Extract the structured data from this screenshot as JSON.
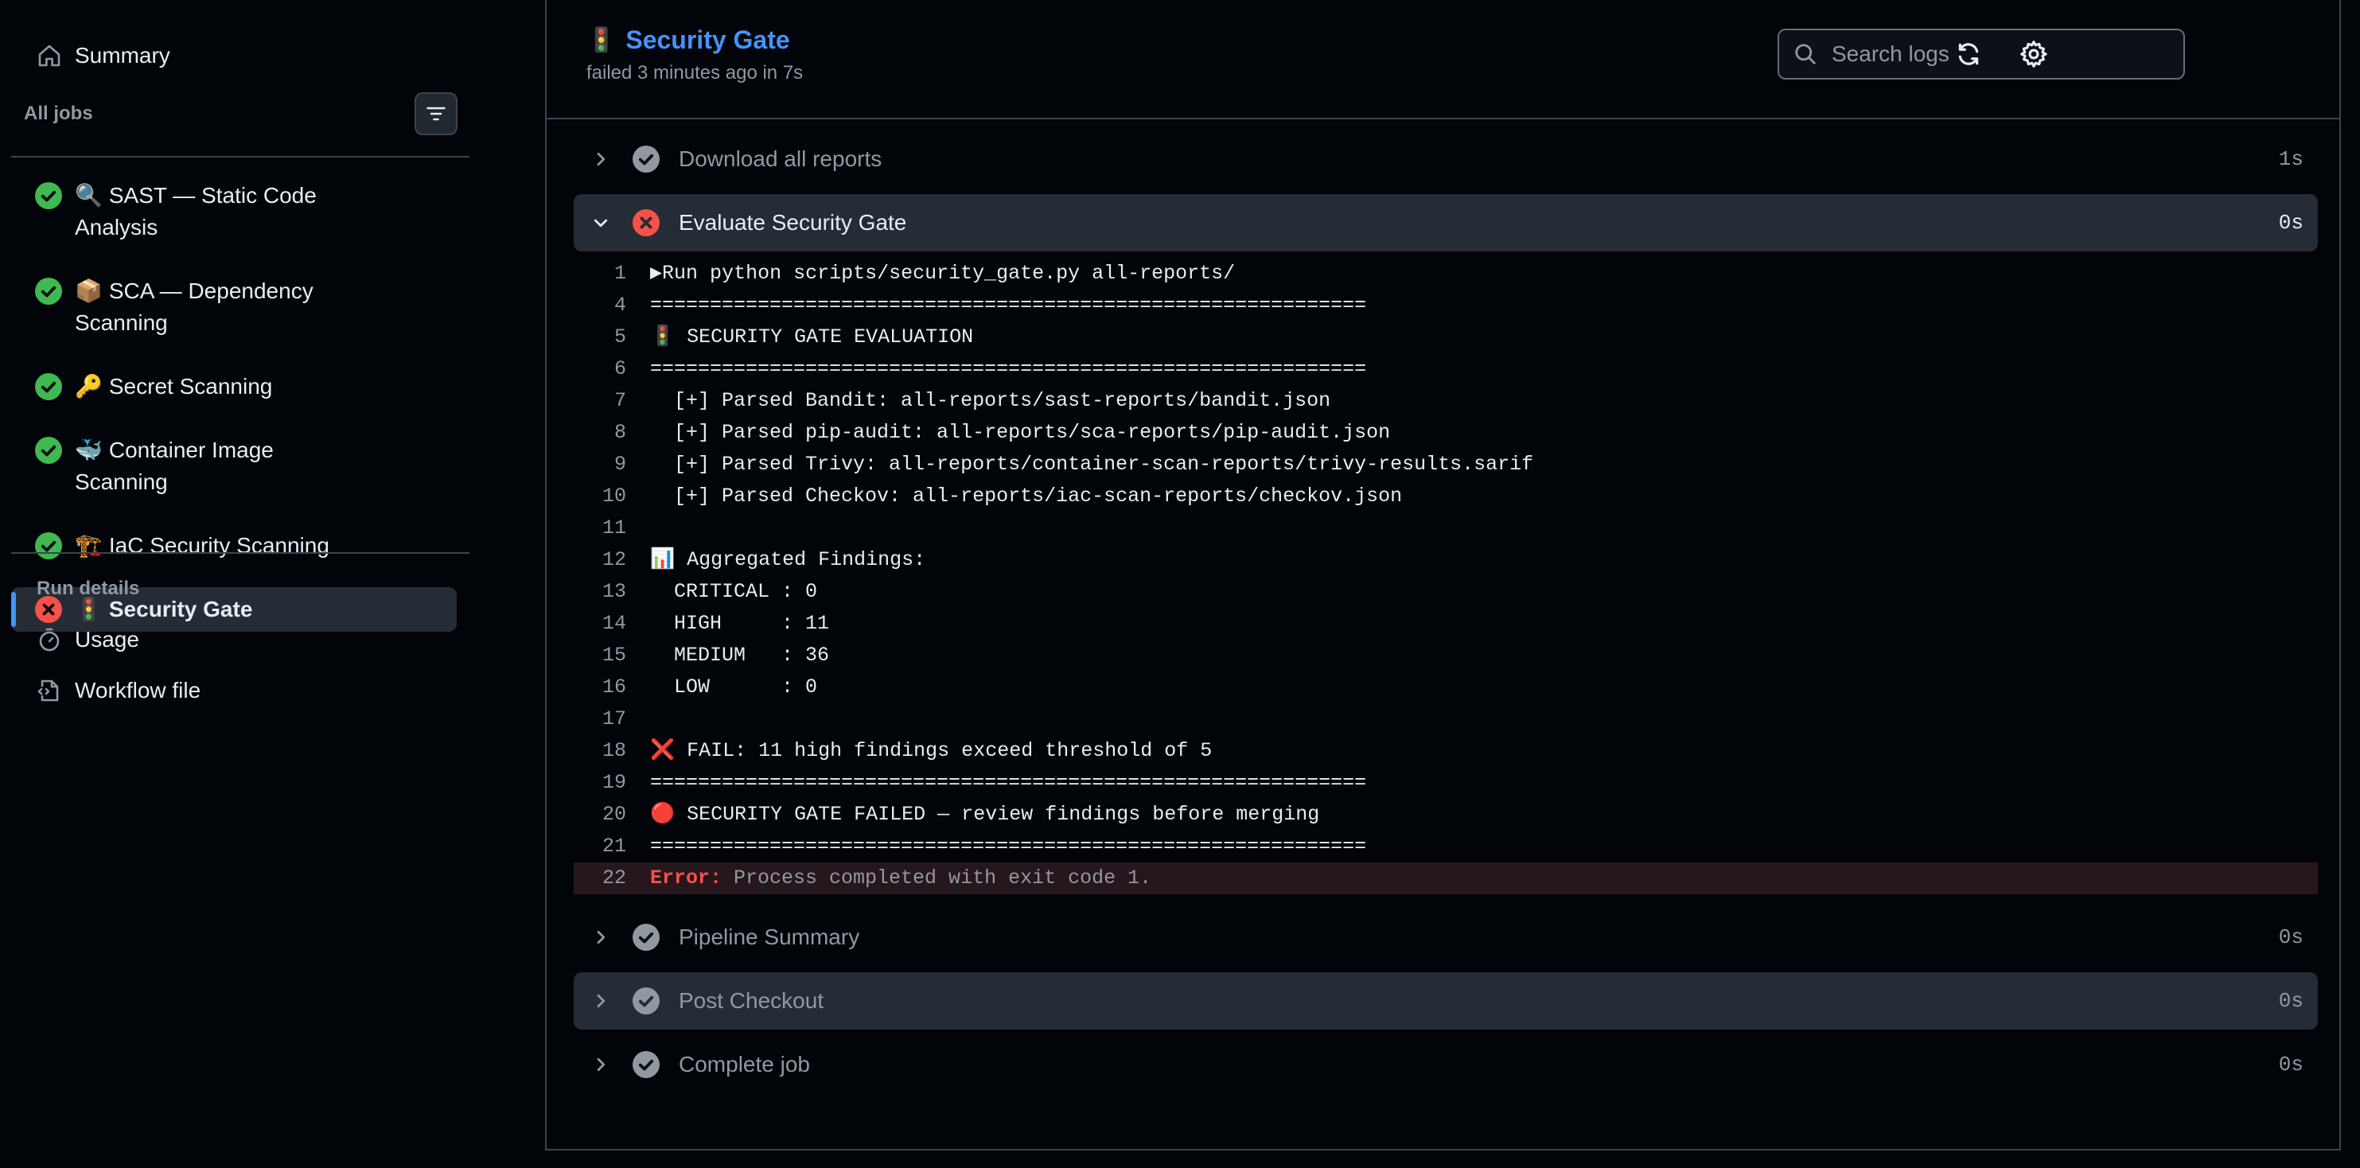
{
  "sidebar": {
    "summary_label": "Summary",
    "all_jobs_label": "All jobs",
    "jobs": [
      {
        "emoji": "🔍",
        "label": "SAST — Static Code Analysis",
        "status": "success"
      },
      {
        "emoji": "📦",
        "label": "SCA — Dependency Scanning",
        "status": "success"
      },
      {
        "emoji": "🔑",
        "label": "Secret Scanning",
        "status": "success"
      },
      {
        "emoji": "🐳",
        "label": "Container Image Scanning",
        "status": "success"
      },
      {
        "emoji": "🏗️",
        "label": "IaC Security Scanning",
        "status": "success"
      },
      {
        "emoji": "🚦",
        "label": "Security Gate",
        "status": "failure"
      }
    ],
    "run_details_label": "Run details",
    "usage_label": "Usage",
    "workflow_file_label": "Workflow file"
  },
  "header": {
    "emoji": "🚦",
    "title": "Security Gate",
    "subtitle": "failed 3 minutes ago in 7s",
    "search_placeholder": "Search logs"
  },
  "steps": [
    {
      "name": "Download all reports",
      "duration": "1s",
      "status": "success"
    },
    {
      "name": "Evaluate Security Gate",
      "duration": "0s",
      "status": "failure"
    },
    {
      "name": "Pipeline Summary",
      "duration": "0s",
      "status": "success"
    },
    {
      "name": "Post Checkout",
      "duration": "0s",
      "status": "success"
    },
    {
      "name": "Complete job",
      "duration": "0s",
      "status": "success"
    }
  ],
  "log": {
    "lines": [
      {
        "num": "1",
        "text": "▶Run python scripts/security_gate.py all-reports/"
      },
      {
        "num": "4",
        "text": "============================================================"
      },
      {
        "num": "5",
        "text": "🚦 SECURITY GATE EVALUATION"
      },
      {
        "num": "6",
        "text": "============================================================"
      },
      {
        "num": "7",
        "text": "  [+] Parsed Bandit: all-reports/sast-reports/bandit.json"
      },
      {
        "num": "8",
        "text": "  [+] Parsed pip-audit: all-reports/sca-reports/pip-audit.json"
      },
      {
        "num": "9",
        "text": "  [+] Parsed Trivy: all-reports/container-scan-reports/trivy-results.sarif"
      },
      {
        "num": "10",
        "text": "  [+] Parsed Checkov: all-reports/iac-scan-reports/checkov.json"
      },
      {
        "num": "11",
        "text": ""
      },
      {
        "num": "12",
        "text": "📊 Aggregated Findings:"
      },
      {
        "num": "13",
        "text": "  CRITICAL : 0"
      },
      {
        "num": "14",
        "text": "  HIGH     : 11"
      },
      {
        "num": "15",
        "text": "  MEDIUM   : 36"
      },
      {
        "num": "16",
        "text": "  LOW      : 0"
      },
      {
        "num": "17",
        "text": ""
      },
      {
        "num": "18",
        "text": "❌ FAIL: 11 high findings exceed threshold of 5"
      },
      {
        "num": "19",
        "text": "============================================================"
      },
      {
        "num": "20",
        "text": "🔴 SECURITY GATE FAILED — review findings before merging"
      },
      {
        "num": "21",
        "text": "============================================================"
      }
    ],
    "error_line": {
      "num": "22",
      "label": "Error:",
      "text": " Process completed with exit code 1."
    }
  },
  "colors": {
    "accent": "#4493f8",
    "success": "#3fb950",
    "failure": "#f85149",
    "neutral_status": "#9198a1"
  }
}
